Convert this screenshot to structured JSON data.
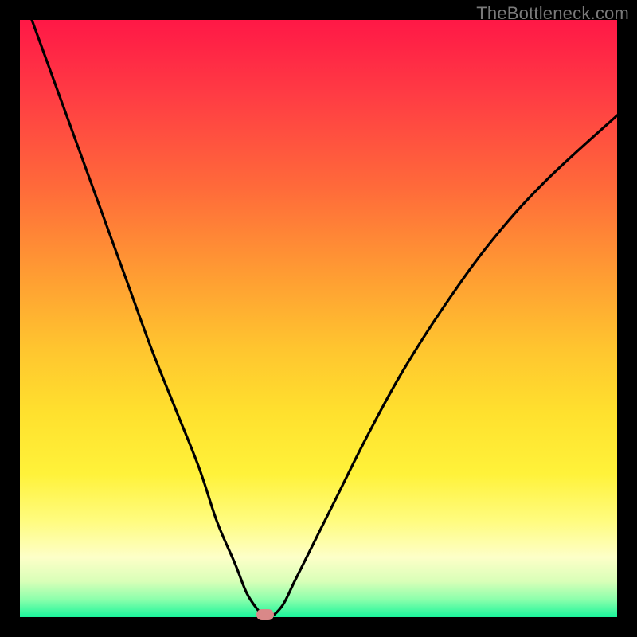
{
  "watermark": "TheBottleneck.com",
  "chart_data": {
    "type": "line",
    "title": "",
    "xlabel": "",
    "ylabel": "",
    "xlim": [
      0,
      100
    ],
    "ylim": [
      0,
      100
    ],
    "grid": false,
    "background_gradient": {
      "orientation": "vertical",
      "stops": [
        {
          "pos": 0,
          "color": "#ff1846"
        },
        {
          "pos": 50,
          "color": "#ffc52f"
        },
        {
          "pos": 85,
          "color": "#fffc80"
        },
        {
          "pos": 100,
          "color": "#19f59b"
        }
      ]
    },
    "series": [
      {
        "name": "bottleneck-curve",
        "color": "#000000",
        "x": [
          2,
          6,
          10,
          14,
          18,
          22,
          26,
          30,
          33,
          36,
          38,
          40,
          41,
          42,
          44,
          46,
          49,
          53,
          58,
          64,
          71,
          79,
          88,
          100
        ],
        "y": [
          100,
          89,
          78,
          67,
          56,
          45,
          35,
          25,
          16,
          9,
          4,
          1,
          0,
          0,
          2,
          6,
          12,
          20,
          30,
          41,
          52,
          63,
          73,
          84
        ]
      }
    ],
    "marker": {
      "x": 41,
      "y": 0,
      "color": "#d98888",
      "shape": "pill"
    }
  }
}
